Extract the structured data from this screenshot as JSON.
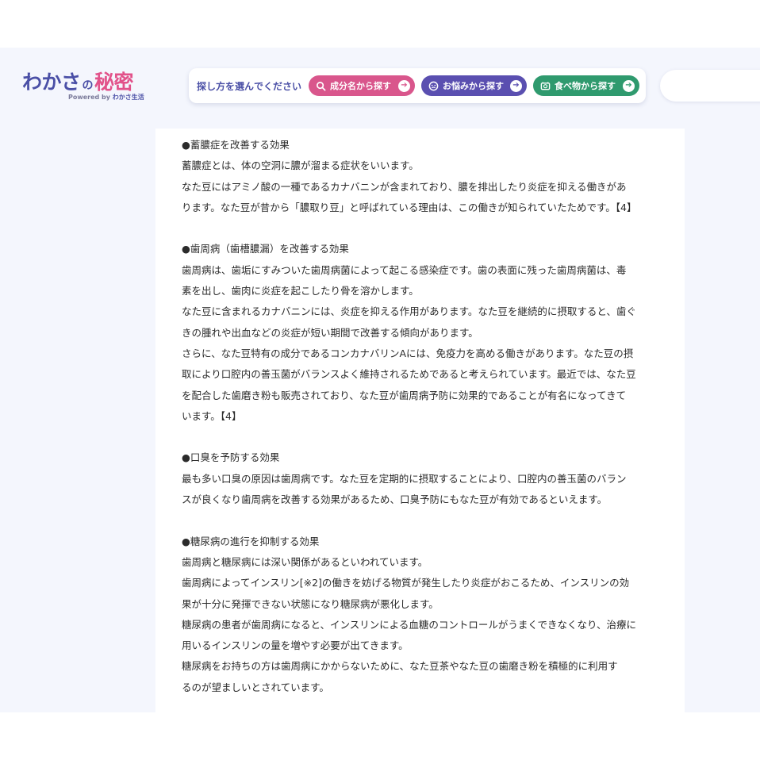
{
  "logo": {
    "wakasa": "わかさ",
    "no": "の",
    "himitsu": "秘密",
    "powered_prefix": "Powered by",
    "powered_brand": "わかさ生活"
  },
  "search_panel": {
    "prompt": "探し方を選んでください",
    "buttons": [
      {
        "label": "成分名から探す",
        "icon": "magnifier-icon",
        "color": "#d9568c"
      },
      {
        "label": "お悩みから探す",
        "icon": "face-icon",
        "color": "#5a4fb0"
      },
      {
        "label": "食べ物から探す",
        "icon": "food-icon",
        "color": "#2f9a6e"
      }
    ]
  },
  "article": {
    "lines": [
      "●蓄膿症を改善する効果",
      "蓄膿症とは、体の空洞に膿が溜まる症状をいいます。",
      "なた豆にはアミノ酸の一種であるカナバニンが含まれており、膿を排出したり炎症を抑える働きがあ",
      "ります。なた豆が昔から「膿取り豆」と呼ばれている理由は、この働きが知られていたためです。【4】",
      "",
      "●歯周病（歯槽膿漏）を改善する効果",
      "歯周病は、歯垢にすみついた歯周病菌によって起こる感染症です。歯の表面に残った歯周病菌は、毒",
      "素を出し、歯肉に炎症を起こしたり骨を溶かします。",
      "なた豆に含まれるカナバニンには、炎症を抑える作用があります。なた豆を継続的に摂取すると、歯ぐ",
      "きの腫れや出血などの炎症が短い期間で改善する傾向があります。",
      "さらに、なた豆特有の成分であるコンカナバリンAには、免疫力を高める働きがあります。なた豆の摂",
      "取により口腔内の善玉菌がバランスよく維持されるためであると考えられています。最近では、なた豆",
      "を配合した歯磨き粉も販売されており、なた豆が歯周病予防に効果的であることが有名になってきて",
      "います。【4】",
      "",
      "●口臭を予防する効果",
      "最も多い口臭の原因は歯周病です。なた豆を定期的に摂取することにより、口腔内の善玉菌のバラン",
      "スが良くなり歯周病を改善する効果があるため、口臭予防にもなた豆が有効であるといえます。",
      "",
      "●糖尿病の進行を抑制する効果",
      "歯周病と糖尿病には深い関係があるといわれています。",
      "歯周病によってインスリン[※2]の働きを妨げる物質が発生したり炎症がおこるため、インスリンの効",
      "果が十分に発揮できない状態になり糖尿病が悪化します。",
      "糖尿病の患者が歯周病になると、インスリンによる血糖のコントロールがうまくできなくなり、治療に",
      "用いるインスリンの量を増やす必要が出てきます。",
      "糖尿病をお持ちの方は歯周病にかからないために、なた豆茶やなた豆の歯磨き粉を積極的に利用す",
      "るのが望ましいとされています。"
    ]
  }
}
